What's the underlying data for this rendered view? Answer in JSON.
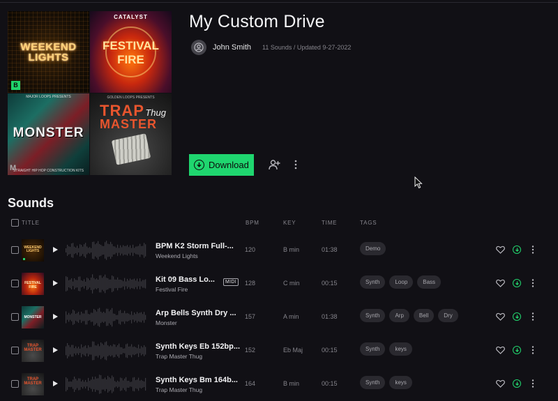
{
  "playlist": {
    "title": "My Custom Drive",
    "owner": "John Smith",
    "meta": "11 Sounds / Updated 9-27-2022",
    "download_label": "Download"
  },
  "covers": [
    {
      "name": "Weekend Lights",
      "line1": "WEEKEND",
      "line2": "LIGHTS",
      "badge": "B"
    },
    {
      "name": "Festival Fire",
      "brand": "CATALYST",
      "line1": "FESTIVAL FIRE"
    },
    {
      "name": "Monster",
      "top": "MAJOR LOOPS PRESENTS",
      "line1": "MONSTER",
      "bottom": "STRAIGHT HIP HOP CONSTRUCTION KITS"
    },
    {
      "name": "Trap Master Thug",
      "brand": "GOLDEN LOOPS PRESENTS",
      "line1": "TRAP",
      "line2": "MASTER",
      "script": "Thug"
    }
  ],
  "sounds": {
    "heading": "Sounds",
    "columns": {
      "title": "TITLE",
      "bpm": "BPM",
      "key": "KEY",
      "time": "TIME",
      "tags": "TAGS"
    },
    "rows": [
      {
        "name": "BPM K2 Storm Full-...",
        "pack": "Weekend Lights",
        "bpm": "120",
        "key": "B min",
        "time": "01:38",
        "tags": [
          "Demo"
        ],
        "midi": "",
        "thumb": "WEEKEND LIGHTS"
      },
      {
        "name": "Kit 09 Bass Lo...",
        "pack": "Festival Fire",
        "bpm": "128",
        "key": "C min",
        "time": "00:15",
        "tags": [
          "Synth",
          "Loop",
          "Bass"
        ],
        "midi": "MIDI",
        "thumb": "FESTIVAL FIRE"
      },
      {
        "name": "Arp Bells Synth Dry ...",
        "pack": "Monster",
        "bpm": "157",
        "key": "A min",
        "time": "01:38",
        "tags": [
          "Synth",
          "Arp",
          "Bell",
          "Dry"
        ],
        "midi": "",
        "thumb": "MONSTER"
      },
      {
        "name": "Synth Keys Eb 152bp...",
        "pack": "Trap Master Thug",
        "bpm": "152",
        "key": "Eb Maj",
        "time": "00:15",
        "tags": [
          "Synth",
          "keys"
        ],
        "midi": "",
        "thumb": "TRAP MASTER"
      },
      {
        "name": "Synth Keys Bm 164b...",
        "pack": "Trap Master Thug",
        "bpm": "164",
        "key": "B min",
        "time": "00:15",
        "tags": [
          "Synth",
          "keys"
        ],
        "midi": "",
        "thumb": "TRAP MASTER"
      }
    ]
  },
  "colors": {
    "accent": "#1fd66f",
    "background": "#111015",
    "tag_bg": "#2a292f"
  }
}
